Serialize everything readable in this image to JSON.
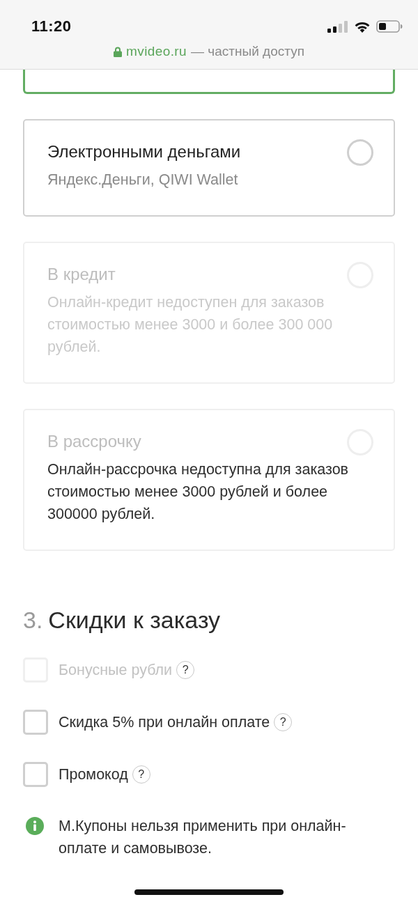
{
  "status_bar": {
    "time": "11:20"
  },
  "address_bar": {
    "domain": "mvideo.ru",
    "suffix": "— частный доступ"
  },
  "payment_options": [
    {
      "selected": true,
      "disabled": false
    },
    {
      "title": "Электронными деньгами",
      "subtitle": "Яндекс.Деньги, QIWI Wallet",
      "selected": false,
      "disabled": false
    },
    {
      "title": "В кредит",
      "subtitle": "Онлайн-кредит недоступен для заказов стоимостью менее 3000 и более 300 000 рублей.",
      "selected": false,
      "disabled": true
    },
    {
      "title": "В рассрочку",
      "note": "Онлайн-рассрочка недоступна для заказов стоимостью менее 3000 рублей и более 300000 рублей.",
      "selected": false,
      "disabled": true
    }
  ],
  "discounts": {
    "number": "3.",
    "title": "Скидки к заказу",
    "options": [
      {
        "label": "Бонусные рубли",
        "help": "?",
        "checked": false,
        "disabled": true
      },
      {
        "label": "Скидка 5% при онлайн оплате",
        "help": "?",
        "checked": false,
        "disabled": false
      },
      {
        "label": "Промокод",
        "help": "?",
        "checked": false,
        "disabled": false
      }
    ]
  },
  "info": {
    "text": "М.Купоны нельзя применить при онлайн-оплате и самовывозе."
  }
}
